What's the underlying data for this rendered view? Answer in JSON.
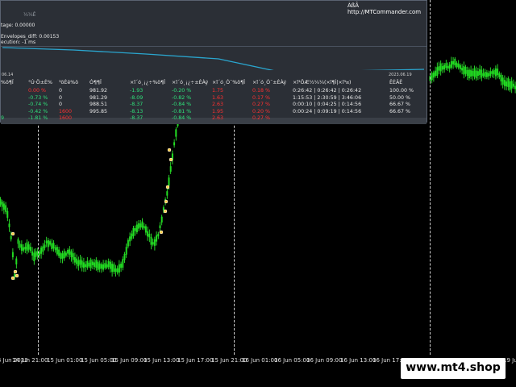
{
  "panel": {
    "link_text": "ÀßÂ http://MTCommander.com",
    "title_faint": "¼¼Ê",
    "line1": "tage: 0.00000",
    "line2": "Envelopes_diff: 0.00153",
    "line3": "ecution: -1 ms",
    "date_left": "06.14",
    "date_right": "2023.06.19",
    "headers": [
      "%ö¶Ï",
      "°Ú·Ö±È%",
      "³öÈë%ö",
      "Ó¶¶Ï",
      "×î´ó¸¡¿÷%ö¶Ï",
      "×î´ó¸¡¿÷±ÈÀý",
      "×î´ó¸Ó¯%ö¶Ï",
      "×î´ó¸Ó¯±ÈÀý",
      "×î³ÖÆ½¼¼(×î¶Ì|×î³¤)",
      "ÊÈÂÊ"
    ],
    "rows": [
      [
        "",
        "0.00 %",
        "0",
        "981.92",
        "-1.93",
        "-0.20 %",
        "1.75",
        "0.18 %",
        "0:26:42 | 0:26:42 | 0:26:42",
        "100.00 %"
      ],
      [
        "",
        "-0.73 %",
        "0",
        "981.29",
        "-8.09",
        "-0.82 %",
        "1.63",
        "0.17 %",
        "1:15:53 | 2:30:59 | 3:46:06",
        "50.00 %"
      ],
      [
        "",
        "-0.74 %",
        "0",
        "988.51",
        "-8.37",
        "-0.84 %",
        "2.63",
        "0.27 %",
        "0:00:10 | 0:04:25 | 0:14:56",
        "66.67 %"
      ],
      [
        "",
        "-0.42 %",
        "1600",
        "995.85",
        "-8.13",
        "-0.81 %",
        "1.95",
        "0.20 %",
        "0:00:24 | 0:09:19 | 0:14:56",
        "66.67 %"
      ],
      [
        "9",
        "-1.81 %",
        "1600",
        "",
        "-8.37",
        "-0.84 %",
        "2.63",
        "0.27 %",
        "",
        ""
      ]
    ]
  },
  "time_axis": [
    "4 Jun 2023",
    "14 Jun 21:00",
    "15 Jun 01:00",
    "15 Jun 05:00",
    "15 Jun 09:00",
    "15 Jun 13:00",
    "15 Jun 17:00",
    "15 Jun 21:00",
    "16 Jun 01:00",
    "16 Jun 05:00",
    "16 Jun 09:00",
    "16 Jun 13:00",
    "16 Jun 17:00",
    "16 Jun 21:00",
    "19 Jun 01:00",
    "19 Jun 05:00",
    "19 Jun"
  ],
  "watermark": "www.mt4.shop",
  "colors": {
    "background": "#000000",
    "candle_body": "#22dd22",
    "candle_wick": "#33ff33",
    "curve": "#2aa6cf",
    "panel_bg": "#2b2f36",
    "positive": "#2fe07a",
    "negative": "#ff3030",
    "grid_dash": "#cfcfcf"
  }
}
